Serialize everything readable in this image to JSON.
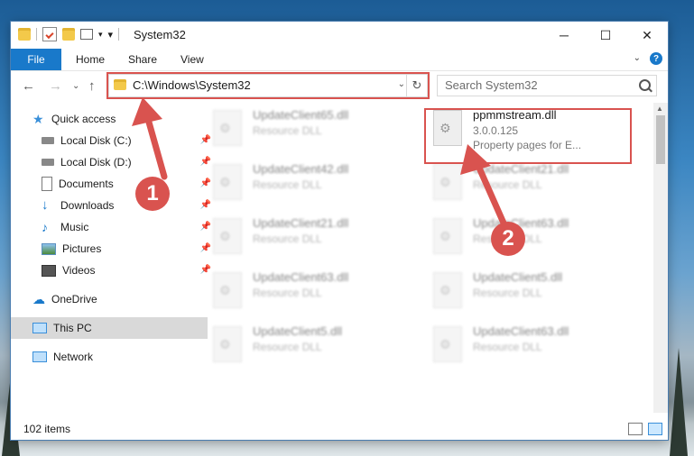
{
  "window": {
    "title": "System32"
  },
  "ribbon": {
    "tabs": [
      "File",
      "Home",
      "Share",
      "View"
    ]
  },
  "addressbar": {
    "path": "C:\\Windows\\System32"
  },
  "search": {
    "placeholder": "Search System32"
  },
  "sidebar": {
    "items": [
      {
        "label": "Quick access",
        "icon": "star-icon",
        "pinned": false
      },
      {
        "label": "Local Disk (C:)",
        "icon": "drive-icon",
        "pinned": true
      },
      {
        "label": "Local Disk (D:)",
        "icon": "drive-icon",
        "pinned": true
      },
      {
        "label": "Documents",
        "icon": "document-icon",
        "pinned": true
      },
      {
        "label": "Downloads",
        "icon": "download-icon",
        "pinned": true
      },
      {
        "label": "Music",
        "icon": "music-icon",
        "pinned": true
      },
      {
        "label": "Pictures",
        "icon": "pictures-icon",
        "pinned": true
      },
      {
        "label": "Videos",
        "icon": "video-icon",
        "pinned": true
      },
      {
        "label": "OneDrive",
        "icon": "cloud-icon",
        "pinned": false
      },
      {
        "label": "This PC",
        "icon": "computer-icon",
        "pinned": false,
        "selected": true
      },
      {
        "label": "Network",
        "icon": "network-icon",
        "pinned": false
      }
    ]
  },
  "files": {
    "highlighted": {
      "name": "ppmmstream.dll",
      "version": "3.0.0.125",
      "description": "Property pages for E..."
    },
    "left_column": [
      {
        "name": "UpdateClient65.dll",
        "type": "Resource DLL"
      },
      {
        "name": "UpdateClient42.dll",
        "type": "Resource DLL"
      },
      {
        "name": "UpdateClient21.dll",
        "type": "Resource DLL"
      },
      {
        "name": "UpdateClient63.dll",
        "type": "Resource DLL"
      },
      {
        "name": "UpdateClient5.dll",
        "type": "Resource DLL"
      }
    ],
    "right_column": [
      {
        "name": "UpdateClient21.dll",
        "type": "Resource DLL"
      },
      {
        "name": "UpdateClient63.dll",
        "type": "Resource DLL"
      },
      {
        "name": "UpdateClient5.dll",
        "type": "Resource DLL"
      },
      {
        "name": "UpdateClient63.dll",
        "type": "Resource DLL"
      }
    ]
  },
  "status": {
    "items_count": "102 items"
  },
  "annotations": {
    "step1": "1",
    "step2": "2"
  },
  "colors": {
    "accent": "#1979ca",
    "highlight": "#d9534f"
  }
}
